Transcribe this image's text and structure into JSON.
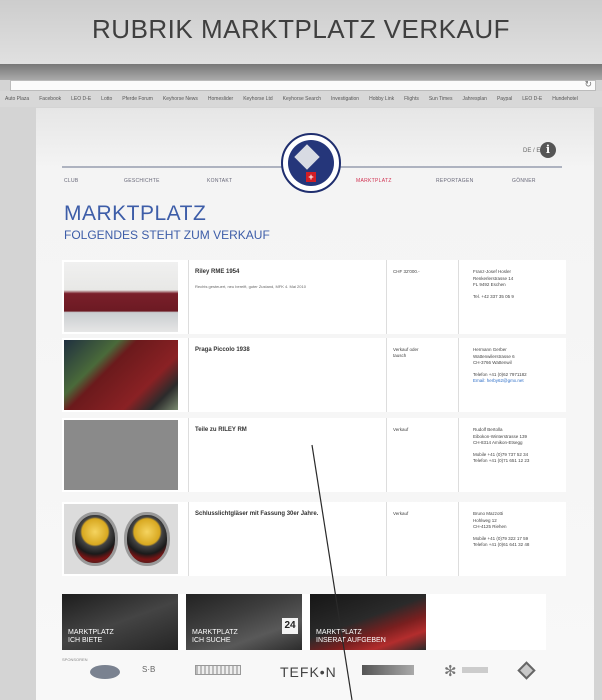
{
  "document_title": "RUBRIK MARKTPLATZ VERKAUF",
  "browser": {
    "reload_glyph": "↻",
    "bookmarks": [
      "Auto Plaza",
      "Facebook",
      "LEO D-E",
      "Lotto",
      "Pferde Forum",
      "Keyhorse News",
      "Homeslider",
      "Keyhorse Ltd",
      "Keyhorse Search",
      "Investigation",
      "Hobby Link",
      "Flights",
      "Sun Times",
      "Jahresplan",
      "Paypal",
      "LEO D-E",
      "Hundehotel"
    ]
  },
  "site": {
    "lang": "DE / E",
    "info_glyph": "i",
    "logo_cross_glyph": "+",
    "nav": [
      "CLUB",
      "GESCHICHTE",
      "KONTAKT",
      "MARKTPLATZ",
      "REPORTAGEN",
      "GÖNNER"
    ],
    "active_nav": "MARKTPLATZ",
    "heading": "MARKTPLATZ",
    "subheading": "FOLGENDES STEHT ZUM VERKAUF"
  },
  "listings": [
    {
      "title": "Riley RME 1954",
      "description": "Rechts gesteuert, neu bereift, guter Zustand, MFK 4. Mai 2010",
      "price": [
        "CHF 32'000.-"
      ],
      "contact": {
        "address": [
          "Franz-Josef Hosler",
          "Renkerlerstrasse 14",
          "FL 9492 Eschen"
        ],
        "phones": [
          "Tel. +42 337 35 05 9"
        ],
        "email": ""
      }
    },
    {
      "title": "Praga Piccolo 1938",
      "description": "",
      "price": [
        "Verkauf oder",
        "tausch"
      ],
      "contact": {
        "address": [
          "Hermann Gerber",
          "Wattenwilerstrasse 6",
          "CH-3766 Wattenwil"
        ],
        "phones": [
          "Telefon +41 (0)62 7971182"
        ],
        "email": "Email: herby62@gmx.net"
      }
    },
    {
      "title": "Teile zu RILEY RM",
      "description": "",
      "price": [
        "Verkauf"
      ],
      "contact": {
        "address": [
          "Rudolf Bertolla",
          "Eibokon-Winterstrasse 139",
          "CH-8314 Amikon-Etsegg"
        ],
        "phones": [
          "Mobile +41 (0)79 737 52 34",
          "Telefon +41 (0)71 651 12 23"
        ],
        "email": ""
      }
    },
    {
      "title": "Schlusslichtgläser mit Fassung 30er Jahre.",
      "description": "",
      "price": [
        "Verkauf"
      ],
      "contact": {
        "address": [
          "Bruno Mazzotti",
          "Hohlweg 12",
          "CH-4125 Riehen"
        ],
        "phones": [
          "Mobile +41 (0)79 322 17 59",
          "Telefon +41 (0)61 641 32 48"
        ],
        "email": ""
      }
    }
  ],
  "banners": [
    {
      "line1": "MARKTPLATZ",
      "line2": "ICH BIETE"
    },
    {
      "line1": "MARKTPLATZ",
      "line2": "ICH SUCHE",
      "badge": "24"
    },
    {
      "line1": "MARKTPLATZ",
      "line2": "INSERAT AUFGEBEN"
    }
  ],
  "sponsors": {
    "label": "SPONSOREN",
    "sb": "S·B",
    "tefkon": "TEFK•N",
    "star": "✻"
  },
  "colors": {
    "accent_blue": "#3d5da8",
    "active_nav": "#d03050",
    "logo_navy": "#25367a",
    "swiss_red": "#d21e25"
  }
}
